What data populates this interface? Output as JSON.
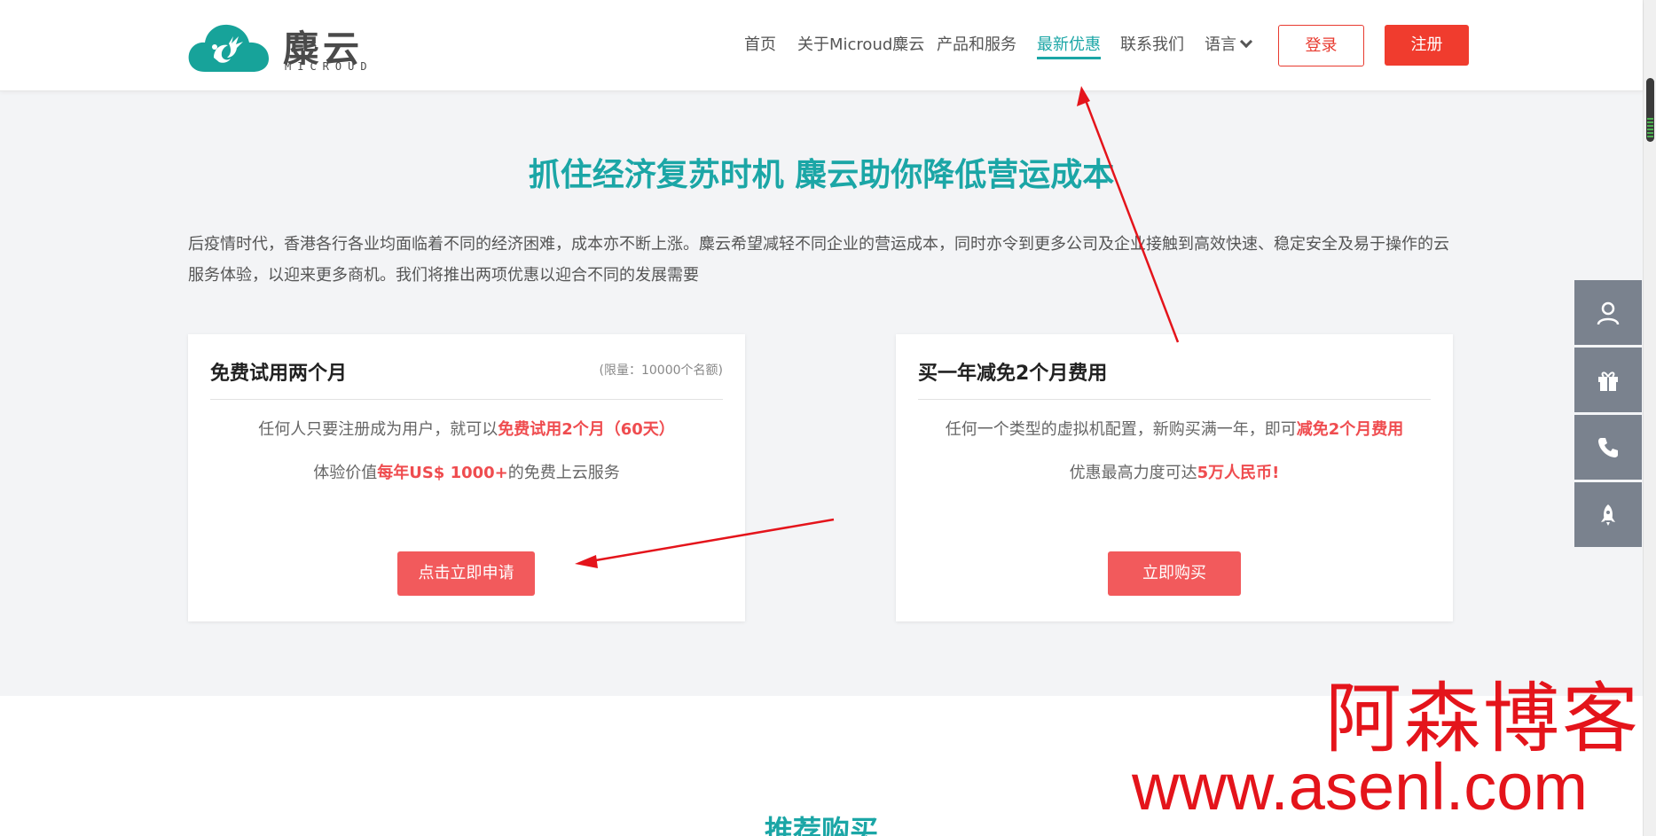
{
  "header": {
    "logo_cn": "麋云",
    "logo_en": "MICROUD",
    "nav": [
      {
        "label": "首页"
      },
      {
        "label": "关于Microud麋云"
      },
      {
        "label": "产品和服务"
      },
      {
        "label": "最新优惠",
        "active": true
      },
      {
        "label": "联系我们"
      },
      {
        "label": "语言"
      }
    ],
    "login_label": "登录",
    "register_label": "注册"
  },
  "promo": {
    "title": "抓住经济复苏时机 麋云助你降低营运成本",
    "description": "后疫情时代，香港各行各业均面临着不同的经济困难，成本亦不断上涨。麋云希望减轻不同企业的营运成本，同时亦令到更多公司及企业接触到高效快速、稳定安全及易于操作的云服务体验，以迎来更多商机。我们将推出两项优惠以迎合不同的发展需要",
    "cards": [
      {
        "title": "免费试用两个月",
        "limit": "(限量：10000个名额)",
        "line1_pre": "任何人只要注册成为用户，就可以",
        "line1_hl": "免费试用2个月（60天）",
        "line2_pre": "体验价值",
        "line2_hl": "每年US$ 1000+",
        "line2_post": "的免费上云服务",
        "button": "点击立即申请"
      },
      {
        "title": "买一年减免2个月费用",
        "line1_pre": "任何一个类型的虚拟机配置，新购买满一年，即可",
        "line1_hl": "减免2个月费用",
        "line2_pre": "优惠最高力度可达",
        "line2_hl": "5万人民币!",
        "button": "立即购买"
      }
    ]
  },
  "next_section_title": "推荐购买",
  "side_bar": [
    "user-icon",
    "gift-icon",
    "phone-icon",
    "rocket-icon"
  ],
  "watermark": {
    "cn": "阿森博客",
    "url": "www.asenl.com"
  },
  "colors": {
    "accent": "#1ba6a6",
    "brand_red": "#f03c2e",
    "highlight": "#ef4c4f",
    "annotation": "#e4141b"
  }
}
